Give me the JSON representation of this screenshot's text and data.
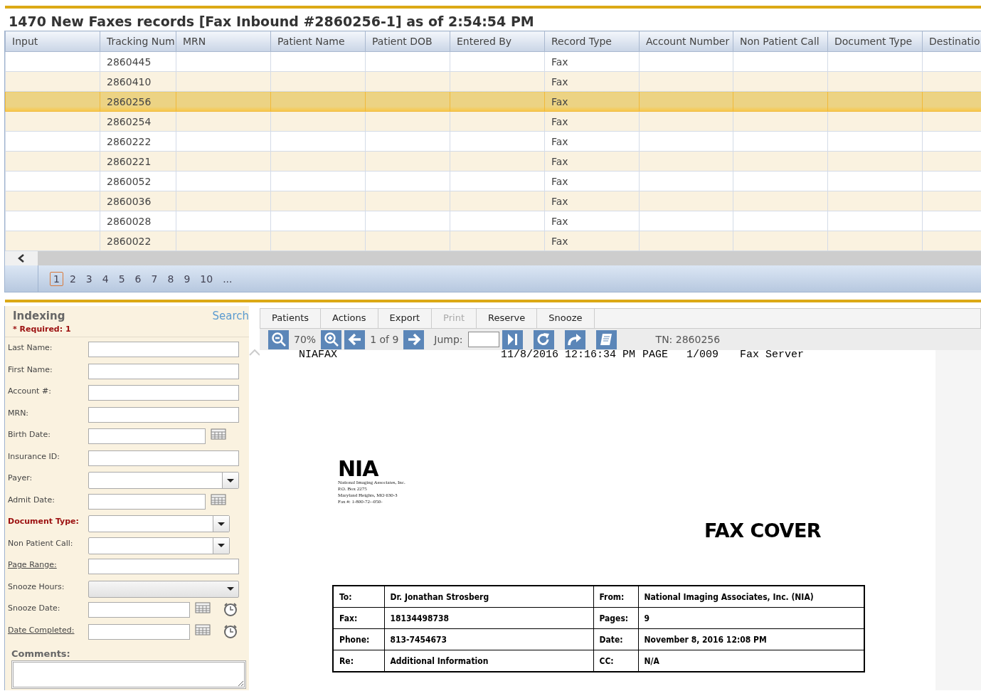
{
  "title": "1470 New Faxes records  [Fax Inbound #2860256-1] as of 2:54:54 PM",
  "table": {
    "columns": [
      "Input",
      "Tracking Num",
      "MRN",
      "Patient Name",
      "Patient DOB",
      "Entered By",
      "Record Type",
      "Account Number",
      "Non Patient Call",
      "Document Type",
      "Destinatio"
    ],
    "rows": [
      {
        "tracking": "2860445",
        "record_type": "Fax",
        "selected": false
      },
      {
        "tracking": "2860410",
        "record_type": "Fax",
        "selected": false
      },
      {
        "tracking": "2860256",
        "record_type": "Fax",
        "selected": true
      },
      {
        "tracking": "2860254",
        "record_type": "Fax",
        "selected": false
      },
      {
        "tracking": "2860222",
        "record_type": "Fax",
        "selected": false
      },
      {
        "tracking": "2860221",
        "record_type": "Fax",
        "selected": false
      },
      {
        "tracking": "2860052",
        "record_type": "Fax",
        "selected": false
      },
      {
        "tracking": "2860036",
        "record_type": "Fax",
        "selected": false
      },
      {
        "tracking": "2860028",
        "record_type": "Fax",
        "selected": false
      },
      {
        "tracking": "2860022",
        "record_type": "Fax",
        "selected": false
      }
    ]
  },
  "pager": [
    {
      "label": "1",
      "selected": true
    },
    {
      "label": "2",
      "selected": false
    },
    {
      "label": "3",
      "selected": false
    },
    {
      "label": "4",
      "selected": false
    },
    {
      "label": "5",
      "selected": false
    },
    {
      "label": "6",
      "selected": false
    },
    {
      "label": "7",
      "selected": false
    },
    {
      "label": "8",
      "selected": false
    },
    {
      "label": "9",
      "selected": false
    },
    {
      "label": "10",
      "selected": false
    },
    {
      "label": "...",
      "selected": false
    }
  ],
  "indexing": {
    "title": "Indexing",
    "search": "Search",
    "required_note": "* Required: 1",
    "fields": [
      {
        "label": "Last Name:",
        "kind": "text",
        "required": false,
        "link": false
      },
      {
        "label": "First Name:",
        "kind": "text",
        "required": false,
        "link": false
      },
      {
        "label": "Account #:",
        "kind": "text",
        "required": false,
        "link": false
      },
      {
        "label": "MRN:",
        "kind": "text",
        "required": false,
        "link": false
      },
      {
        "label": "Birth Date:",
        "kind": "date",
        "required": false,
        "link": false
      },
      {
        "label": "Insurance ID:",
        "kind": "text",
        "required": false,
        "link": false
      },
      {
        "label": "Payer:",
        "kind": "select",
        "required": false,
        "link": false
      },
      {
        "label": "Admit Date:",
        "kind": "date",
        "required": false,
        "link": false
      },
      {
        "label": "Document Type:",
        "kind": "select-short",
        "required": true,
        "link": false
      },
      {
        "label": "Non Patient Call:",
        "kind": "select-short",
        "required": false,
        "link": false
      },
      {
        "label": "Page Range:",
        "kind": "text",
        "required": false,
        "link": true
      },
      {
        "label": "Snooze Hours:",
        "kind": "dropdown",
        "required": false,
        "link": false
      },
      {
        "label": "Snooze Date:",
        "kind": "datetime",
        "required": false,
        "link": false
      },
      {
        "label": "Date Completed:",
        "kind": "datetime",
        "required": false,
        "link": true
      }
    ],
    "comments_label": "Comments:"
  },
  "menu": [
    {
      "label": "Patients",
      "disabled": false
    },
    {
      "label": "Actions",
      "disabled": false
    },
    {
      "label": "Export",
      "disabled": false
    },
    {
      "label": "Print",
      "disabled": true
    },
    {
      "label": "Reserve",
      "disabled": false
    },
    {
      "label": "Snooze",
      "disabled": false
    }
  ],
  "viewer": {
    "zoom": "70%",
    "page": "1 of 9",
    "jump_label": "Jump:",
    "tn": "TN: 2860256"
  },
  "document": {
    "header": [
      "NIAFAX",
      "11/8/2016 12:16:34 PM",
      "PAGE",
      "1/009",
      "Fax Server"
    ],
    "logo": "NIA",
    "address": [
      "National Imaging Associates, Inc.",
      "P.O. Box 2275",
      "Maryland Heights, MO 630-3",
      "Fax #: 1-800-72--050-"
    ],
    "heading": "FAX COVER",
    "cover": [
      [
        "To:",
        "Dr. Jonathan  Strosberg",
        "From:",
        "National Imaging Associates, Inc. (NIA)"
      ],
      [
        "Fax:",
        "18134498738",
        "Pages:",
        "9"
      ],
      [
        "Phone:",
        "813-7454673",
        "Date:",
        "November 8, 2016 12:08 PM"
      ],
      [
        "Re:",
        "Additional Information",
        "CC:",
        "N/A"
      ]
    ]
  }
}
